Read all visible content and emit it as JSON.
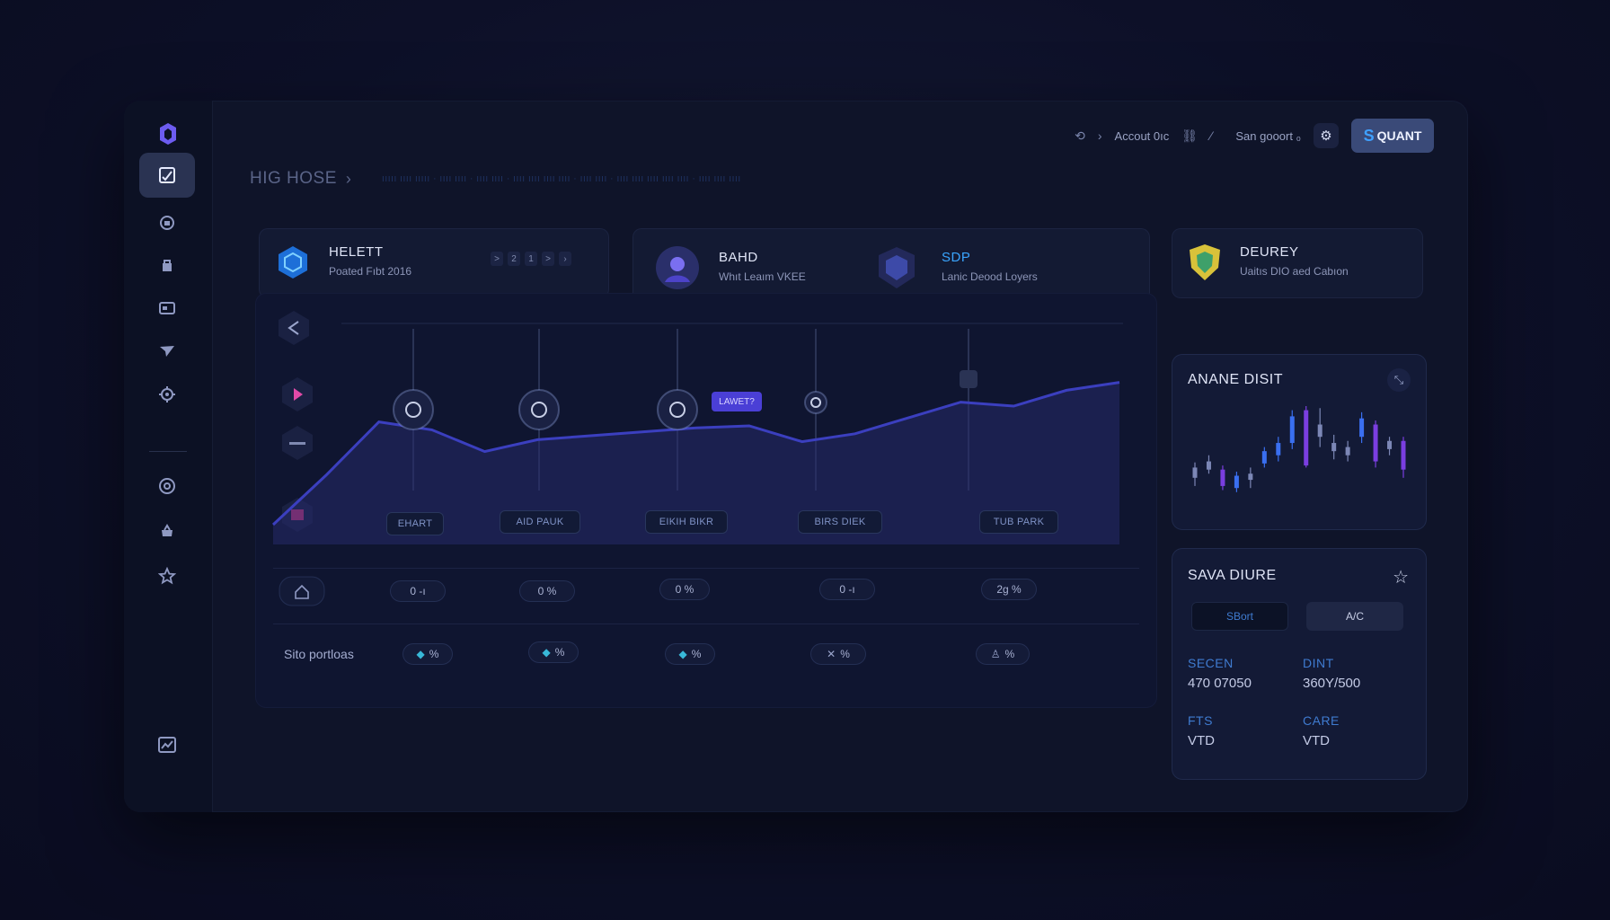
{
  "header": {
    "title": "HIG HOSE",
    "trail": "ııııı ıııı ııııı · ıııı ıııı · ıııı ıııı · ıııı ıııı ıııı ıııı · ıııı ıııı · ıııı ıııı ıııı ıııı ıııı · ıııı ıııı ıııı",
    "account_label": "Accout 0ıc",
    "user_label": "San gooort ₀",
    "quant_label": "QUANT",
    "quant_prefix": "S"
  },
  "sidebar": {
    "items": [
      {
        "icon": "chart-check-icon",
        "active": true
      },
      {
        "icon": "lock-round-icon"
      },
      {
        "icon": "bag-icon"
      },
      {
        "icon": "card-icon"
      },
      {
        "icon": "send-icon"
      },
      {
        "icon": "settings-icon"
      },
      {
        "icon": "globe-icon"
      },
      {
        "icon": "basket-icon"
      },
      {
        "icon": "star-icon"
      },
      {
        "icon": "monitor-icon"
      }
    ]
  },
  "cards": [
    {
      "title": "HELETT",
      "subtitle": "Poated Fıbt 2016",
      "pager": [
        ">",
        "2",
        "1",
        ">",
        "›"
      ]
    },
    {
      "title": "BAHD",
      "subtitle": "Whıt Leaım VKEE"
    },
    {
      "title": "SDP",
      "subtitle": "Lanic Deood Loyers"
    },
    {
      "title": "DEUREY",
      "subtitle": "Uaitıs DIO aed Cabıon"
    }
  ],
  "chart": {
    "tag": "LAWET?",
    "node_labels": [
      "EHART",
      "AID PAUK",
      "EIKIH BIKR",
      "BIRS DIEK",
      "TUB PARK"
    ],
    "value_pills": [
      "0 -ı",
      "0 %",
      "0 %",
      "0 -ı",
      "2g %"
    ],
    "row_label": "Sito portloas",
    "portion_pills": [
      "%",
      "%",
      "%",
      "%",
      "%"
    ]
  },
  "chart_data": {
    "type": "area",
    "title": "",
    "xlabel": "",
    "ylabel": "",
    "series": [
      {
        "values": [
          0.1,
          0.35,
          0.62,
          0.58,
          0.47,
          0.53,
          0.55,
          0.57,
          0.59,
          0.6,
          0.52,
          0.56,
          0.64,
          0.72,
          0.7,
          0.78,
          0.82
        ]
      }
    ],
    "colors": {
      "line": "#3b3fbf",
      "fill": "#262a6a"
    }
  },
  "analytics": {
    "title": "ANANE DISIT",
    "candles": [
      {
        "o": 30,
        "c": 40,
        "h": 45,
        "l": 22,
        "color": "#7c87b6"
      },
      {
        "o": 38,
        "c": 46,
        "h": 52,
        "l": 34,
        "color": "#7c87b6"
      },
      {
        "o": 22,
        "c": 38,
        "h": 42,
        "l": 18,
        "color": "#7a3ee0"
      },
      {
        "o": 20,
        "c": 32,
        "h": 36,
        "l": 16,
        "color": "#3a6ff0"
      },
      {
        "o": 28,
        "c": 34,
        "h": 40,
        "l": 20,
        "color": "#7c87b6"
      },
      {
        "o": 44,
        "c": 56,
        "h": 60,
        "l": 40,
        "color": "#3a6ff0"
      },
      {
        "o": 52,
        "c": 64,
        "h": 70,
        "l": 46,
        "color": "#3a6ff0"
      },
      {
        "o": 64,
        "c": 90,
        "h": 96,
        "l": 58,
        "color": "#3a6ff0"
      },
      {
        "o": 42,
        "c": 96,
        "h": 100,
        "l": 40,
        "color": "#7a3ee0"
      },
      {
        "o": 70,
        "c": 82,
        "h": 98,
        "l": 60,
        "color": "#7c87b6"
      },
      {
        "o": 56,
        "c": 64,
        "h": 72,
        "l": 48,
        "color": "#7c87b6"
      },
      {
        "o": 52,
        "c": 60,
        "h": 66,
        "l": 46,
        "color": "#7c87b6"
      },
      {
        "o": 70,
        "c": 88,
        "h": 94,
        "l": 64,
        "color": "#3a6ff0"
      },
      {
        "o": 46,
        "c": 82,
        "h": 86,
        "l": 40,
        "color": "#7a3ee0"
      },
      {
        "o": 58,
        "c": 66,
        "h": 70,
        "l": 52,
        "color": "#7c87b6"
      },
      {
        "o": 38,
        "c": 66,
        "h": 70,
        "l": 30,
        "color": "#7a3ee0"
      }
    ]
  },
  "save_panel": {
    "title": "SAVA DIURE",
    "seg_left": "SBort",
    "seg_right": "A/C",
    "fields": [
      {
        "key": "SECEN",
        "value": "470 07050"
      },
      {
        "key": "DINT",
        "value": "360Y/500"
      },
      {
        "key": "FTS",
        "value": "VTD"
      },
      {
        "key": "CARE",
        "value": "VTD"
      }
    ]
  }
}
